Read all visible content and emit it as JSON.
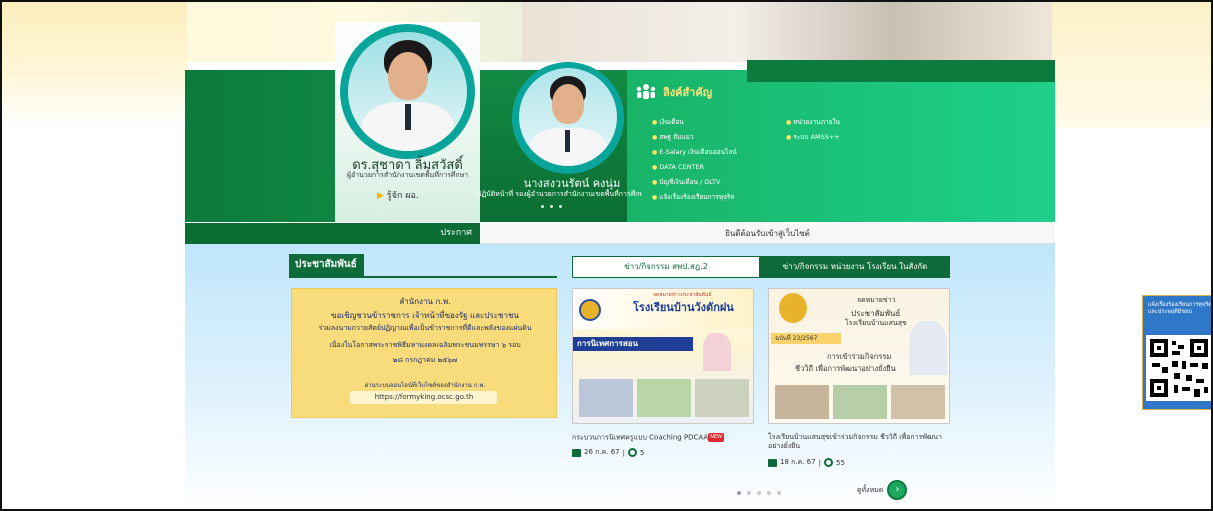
{
  "director_1": {
    "name": "ดร.สุชาดา ลิ้มสวัสดิ์",
    "role": "ผู้อำนวยการสำนักงานเขตพื้นที่การศึกษา",
    "know_link": "รู้จัก ผอ."
  },
  "director_2": {
    "name": "นางสงวนรัตน์ คงนุ่ม",
    "role": "ปฏิบัติหน้าที่ รองผู้อำนวยการสำนักงานเขตพื้นที่การศึกษา"
  },
  "important_links": {
    "title": "ลิงค์สำคัญ",
    "col1": [
      "เงินเดือน",
      "สพฐ ส้มแมว",
      "E-Salary เงินเดือนออนไลน์",
      "DATA CENTER",
      "บัญชีเงินเดือน / DLTV",
      "แจ้งเรื่องร้องเรียนการทุจริต"
    ],
    "col2": [
      "หน่วยงานภายใน",
      "ระบบ AMSS++"
    ]
  },
  "announcement": {
    "label": "ประกาศ",
    "text": "ยินดีต้อนรับเข้าสู่เว็บไซต์"
  },
  "pr": {
    "title": "ประชาสัมพันธ์",
    "poster": {
      "line1": "สำนักงาน ก.พ.",
      "line2": "ขอเชิญชวนข้าราชการ เจ้าหน้าที่ของรัฐ และประชาชน",
      "line3": "ร่วมลงนามถวายสัตย์ปฏิญาณเพื่อเป็นข้าราชการที่ดีและพลังของแผ่นดิน",
      "line4": "เนื่องในโอกาสพระราชพิธีมหามงคลเฉลิมพระชนมพรรษา ๖ รอบ",
      "line5": "๒๘ กรกฎาคม ๒๕๖๗",
      "line6": "ผ่านระบบออนไลน์ที่เว็บไซต์ของสำนักงาน ก.พ.",
      "url": "https://formyking.ocsc.go.th"
    }
  },
  "news": {
    "tab_1": "ข่าว/กิจกรรม สพป.สฎ.2",
    "tab_2": "ข่าว/กิจกรรม หน่วยงาน โรงเรียน ในสังกัด",
    "items": [
      {
        "banner_small": "จดหมายข่าวประชาสัมพันธ์",
        "banner_title": "โรงเรียนบ้านวังตักฝน",
        "banner_sub": "การนิเทศการสอน",
        "caption": "กระบวนการนิเทศครูแบบ Coaching PDCAA",
        "badge": "NEW",
        "date": "26 ก.ค. 67",
        "views": "5"
      },
      {
        "banner_small": "จดหมายข่าว",
        "banner_title": "ประชาสัมพันธ์",
        "banner_title2": "โรงเรียนบ้านแสนสุข",
        "issue": "ฉบับที่ 23/2567",
        "banner_sub": "การเข้าร่วมกิจกรรม",
        "banner_sub2": "ชีววิถี เพื่อการพัฒนาอย่างยั่งยืน",
        "caption": "โรงเรียนบ้านแสนสุขเข้าร่วมกิจกรรม ชีววิถี เพื่อการพัฒนาอย่างยั่งยืน",
        "date": "18 ก.ค. 67",
        "views": "55"
      }
    ],
    "view_all": "ดูทั้งหมด"
  },
  "side_widget": {
    "text": "แจ้งเรื่องร้องเรียนการทุจริตและประพฤติมิชอบ"
  },
  "icons": {
    "links_icon": "people-group-icon",
    "view_all_icon": "chevron-right-icon",
    "calendar_icon": "calendar-icon",
    "views_icon": "eye-icon"
  },
  "colors": {
    "primary_green": "#0f6b3a",
    "accent_green": "#1ec781",
    "link_yellow": "#ffe27a",
    "new_red": "#e0282f"
  }
}
